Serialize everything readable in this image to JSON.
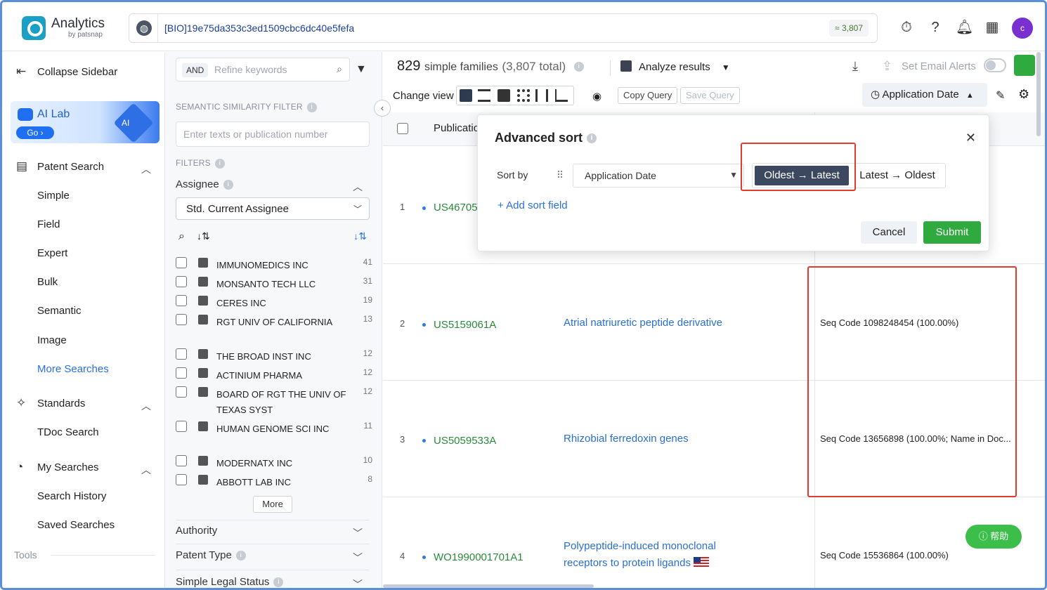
{
  "app": {
    "name": "Analytics",
    "sub": "by patsnap"
  },
  "search": {
    "query": "[BIO]19e75da353c3ed1509cbc6dc40e5fefa",
    "count": "≈ 3,807"
  },
  "user": {
    "initial": "c"
  },
  "sidebar": {
    "collapse": "Collapse Sidebar",
    "ai_lab": {
      "title": "AI Lab",
      "go": "Go ›",
      "badge": "AI"
    },
    "patent_search": "Patent Search",
    "patent_items": [
      "Simple",
      "Field",
      "Expert",
      "Bulk",
      "Semantic",
      "Image"
    ],
    "more_searches": "More Searches",
    "standards": "Standards",
    "tdoc": "TDoc Search",
    "my_searches": "My Searches",
    "history": "Search History",
    "saved": "Saved Searches",
    "tools": "Tools"
  },
  "filters": {
    "and": "AND",
    "refine_placeholder": "Refine keywords",
    "semantic_label": "SEMANTIC SIMILARITY FILTER",
    "semantic_placeholder": "Enter texts or publication number",
    "filters_label": "FILTERS",
    "assignee_label": "Assignee",
    "assignee_select": "Std. Current Assignee",
    "assignees": [
      {
        "name": "IMMUNOMEDICS INC",
        "count": "41"
      },
      {
        "name": "MONSANTO TECH LLC",
        "count": "31"
      },
      {
        "name": "CERES INC",
        "count": "19"
      },
      {
        "name": "RGT UNIV OF CALIFORNIA",
        "count": "13"
      },
      {
        "name": "THE BROAD INST INC",
        "count": "12"
      },
      {
        "name": "ACTINIUM PHARMA",
        "count": "12"
      },
      {
        "name": "BOARD OF RGT THE UNIV OF TEXAS SYST",
        "count": "12"
      },
      {
        "name": "HUMAN GENOME SCI INC",
        "count": "11"
      },
      {
        "name": "MODERNATX INC",
        "count": "10"
      },
      {
        "name": "ABBOTT LAB INC",
        "count": "8"
      }
    ],
    "more": "More",
    "authority": "Authority",
    "patent_type": "Patent Type",
    "legal_status": "Simple Legal Status"
  },
  "results": {
    "count_num": "829",
    "count_text": "simple families",
    "total": "(3,807 total)",
    "analyze": "Analyze results",
    "email": "Set Email Alerts",
    "change_view": "Change view",
    "copy_query": "Copy Query",
    "save_query": "Save Query",
    "sort_button": "Application Date",
    "col_pub": "Publicatio",
    "rows": [
      {
        "num": "1",
        "pub": "US46705",
        "title": "",
        "seq": ""
      },
      {
        "num": "2",
        "pub": "US5159061A",
        "title": "Atrial natriuretic peptide derivative",
        "seq": "Seq Code 1098248454 (100.00%)"
      },
      {
        "num": "3",
        "pub": "US5059533A",
        "title": "Rhizobial ferredoxin genes",
        "seq": "Seq Code 13656898 (100.00%; Name in Doc..."
      },
      {
        "num": "4",
        "pub": "WO1990001701A1",
        "title": "Polypeptide-induced monoclonal receptors to protein ligands",
        "seq": "Seq Code 15536864 (100.00%)"
      }
    ]
  },
  "advanced_sort": {
    "title": "Advanced sort",
    "sort_by": "Sort by",
    "field": "Application Date",
    "oldest_latest": "Oldest → Latest",
    "latest_oldest": "Latest → Oldest",
    "add_field": "+  Add sort field",
    "cancel": "Cancel",
    "submit": "Submit"
  },
  "help": "ⓘ 帮助",
  "colors": {
    "accent": "#2a6fe4",
    "green": "#2eaa3f",
    "highlight": "#e23b2e"
  }
}
